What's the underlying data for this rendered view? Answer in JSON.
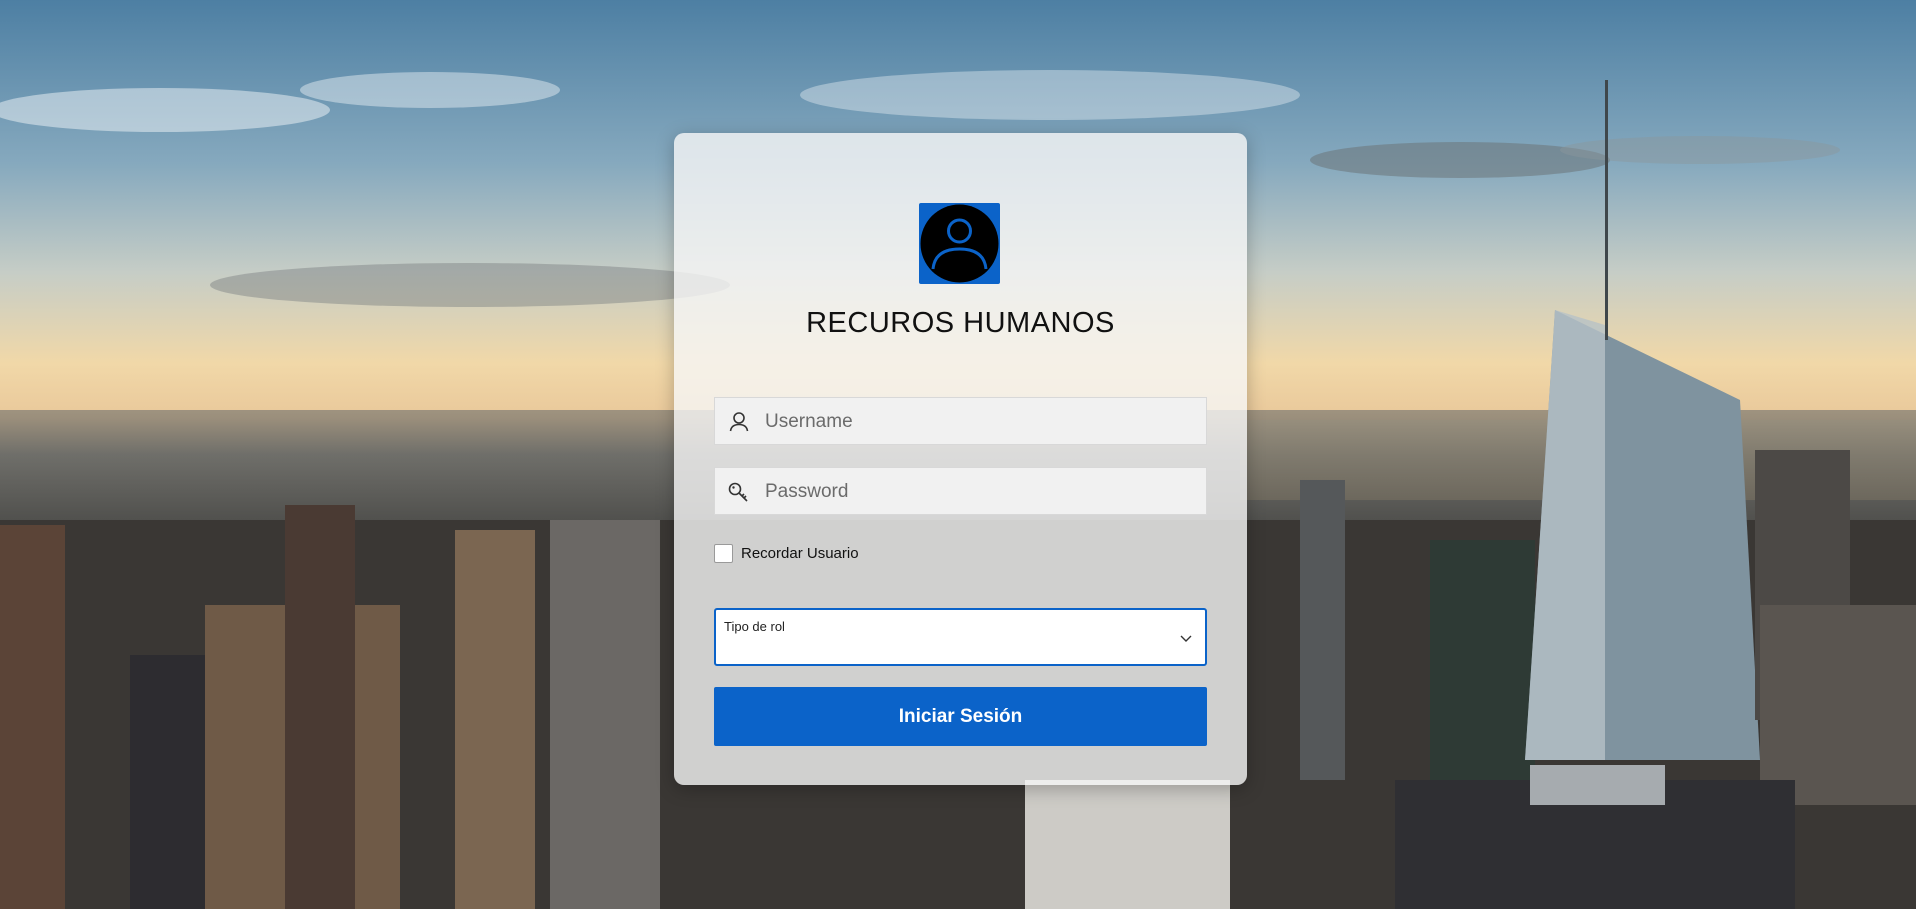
{
  "colors": {
    "accent": "#0b63c9",
    "field_bg": "#f1f1f1",
    "card_bg": "rgba(246,246,246,0.80)"
  },
  "background": {
    "description_icon": "city-skyline-background"
  },
  "login": {
    "logo_icon": "user-avatar-icon",
    "title": "RECUROS HUMANOS",
    "username": {
      "placeholder": "Username",
      "value": "",
      "icon": "user-icon"
    },
    "password": {
      "placeholder": "Password",
      "value": "",
      "icon": "key-icon"
    },
    "remember": {
      "label": "Recordar Usuario",
      "checked": false
    },
    "role_select": {
      "label": "Tipo de rol",
      "selected": "",
      "icon": "chevron-down-icon"
    },
    "submit_label": "Iniciar Sesión"
  }
}
